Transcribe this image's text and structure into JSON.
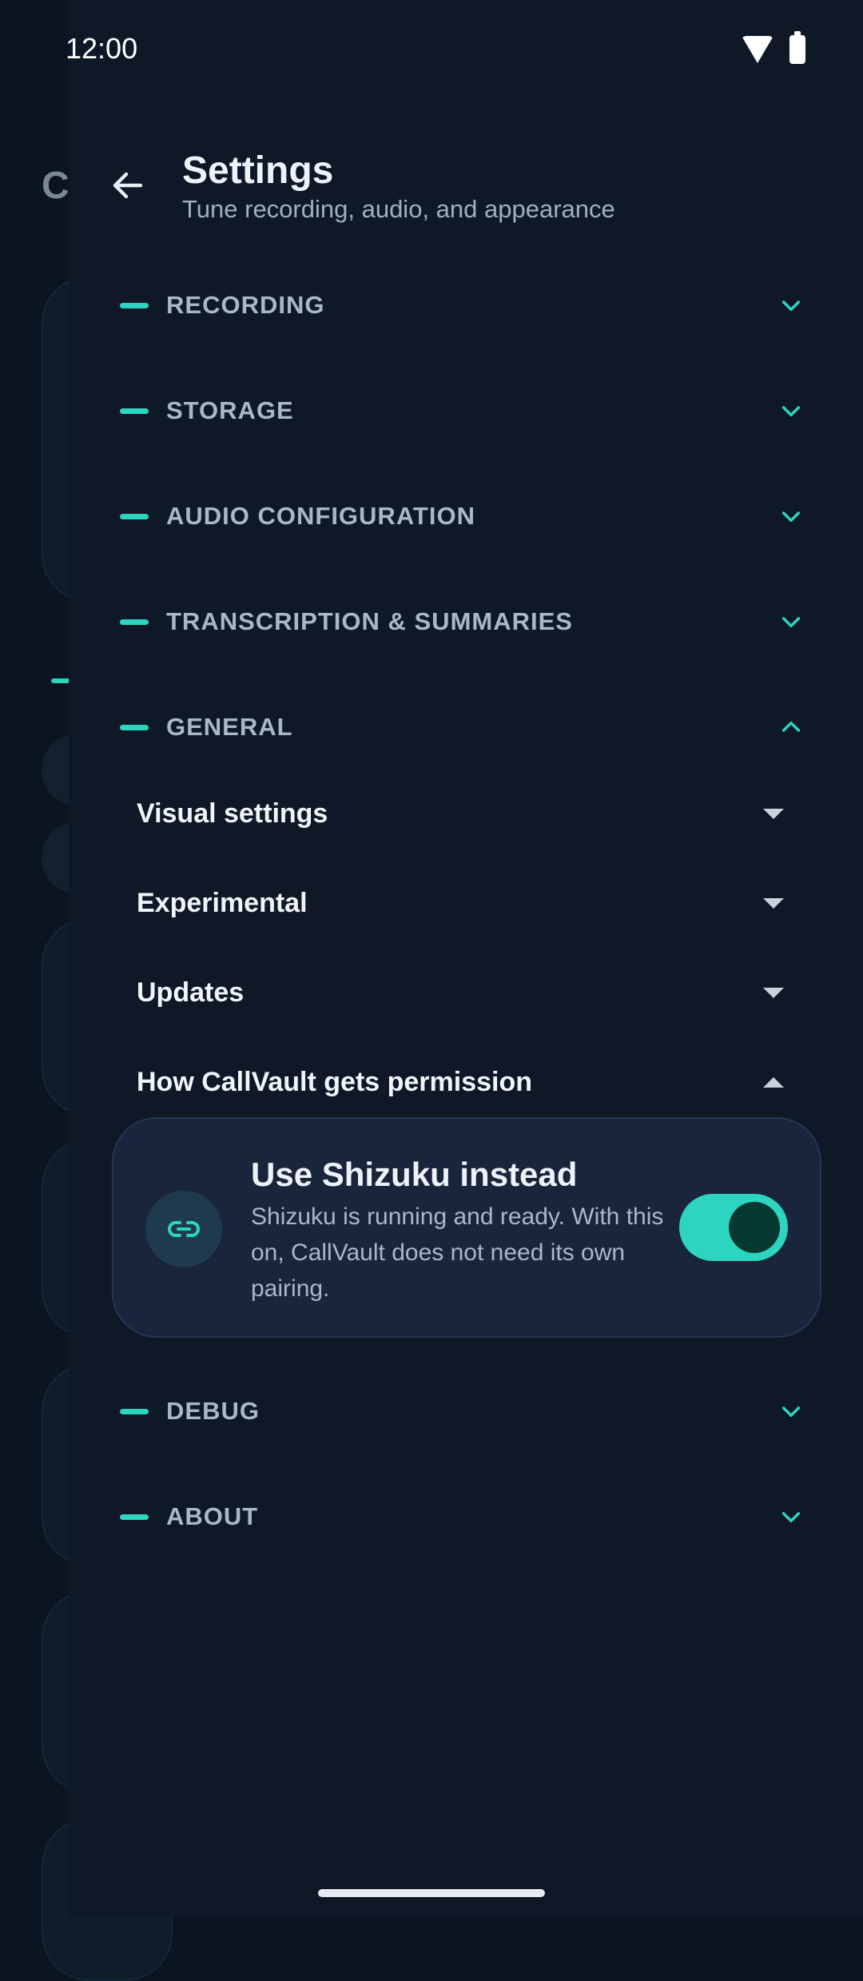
{
  "status_bar": {
    "time": "12:00",
    "wifi_icon": "wifi-icon",
    "battery_icon": "battery-icon"
  },
  "background_page": {
    "partial_title": "C"
  },
  "header": {
    "back_icon": "arrow-left-icon",
    "title": "Settings",
    "subtitle": "Tune recording, audio, and appearance"
  },
  "sections": {
    "recording": {
      "label": "RECORDING",
      "expanded": false
    },
    "storage": {
      "label": "STORAGE",
      "expanded": false
    },
    "audio": {
      "label": "AUDIO CONFIGURATION",
      "expanded": false
    },
    "transcription": {
      "label": "TRANSCRIPTION & SUMMARIES",
      "expanded": false
    },
    "general": {
      "label": "GENERAL",
      "expanded": true,
      "items": {
        "visual": {
          "label": "Visual settings",
          "expanded": false
        },
        "experimental": {
          "label": "Experimental",
          "expanded": false
        },
        "updates": {
          "label": "Updates",
          "expanded": false
        },
        "permission": {
          "label": "How CallVault gets permission",
          "expanded": true
        }
      }
    },
    "debug": {
      "label": "DEBUG",
      "expanded": false
    },
    "about": {
      "label": "ABOUT",
      "expanded": false
    }
  },
  "shizuku_card": {
    "icon": "link-icon",
    "title": "Use Shizuku instead",
    "description": "Shizuku is running and ready. With this on, CallVault does not need its own pairing.",
    "toggle_on": true
  },
  "colors": {
    "accent": "#2dd4bf",
    "background": "#0b1521",
    "drawer": "#0e1826",
    "card": "#18253b"
  }
}
